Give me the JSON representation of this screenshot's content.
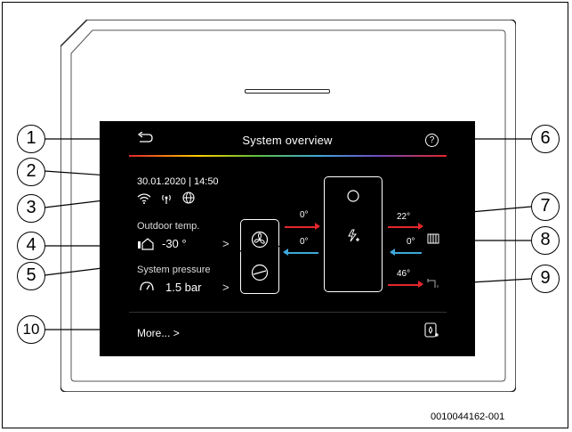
{
  "screen": {
    "back_icon": "back-arrow-icon",
    "title": "System overview",
    "help_label": "?",
    "date_time": "30.01.2020 | 14:50",
    "status_icons": [
      "wifi-icon",
      "signal-icon",
      "globe-icon"
    ],
    "outdoor": {
      "label": "Outdoor temp.",
      "value": "-30 °",
      "chevron": ">"
    },
    "pressure": {
      "label": "System pressure",
      "value": "1.5 bar",
      "chevron": ">"
    },
    "flow_left_top": "0°",
    "flow_left_bottom": "0°",
    "flow_right_top": "22°",
    "flow_right_middle": "0°",
    "flow_right_bottom": "46°",
    "more_label": "More...",
    "more_chevron": ">",
    "colors": {
      "red": "#e3262b",
      "blue": "#3fa7d9",
      "background": "#000000"
    }
  },
  "callouts": [
    "1",
    "2",
    "3",
    "4",
    "5",
    "6",
    "7",
    "8",
    "9",
    "10"
  ],
  "figure_code": "0010044162-001"
}
